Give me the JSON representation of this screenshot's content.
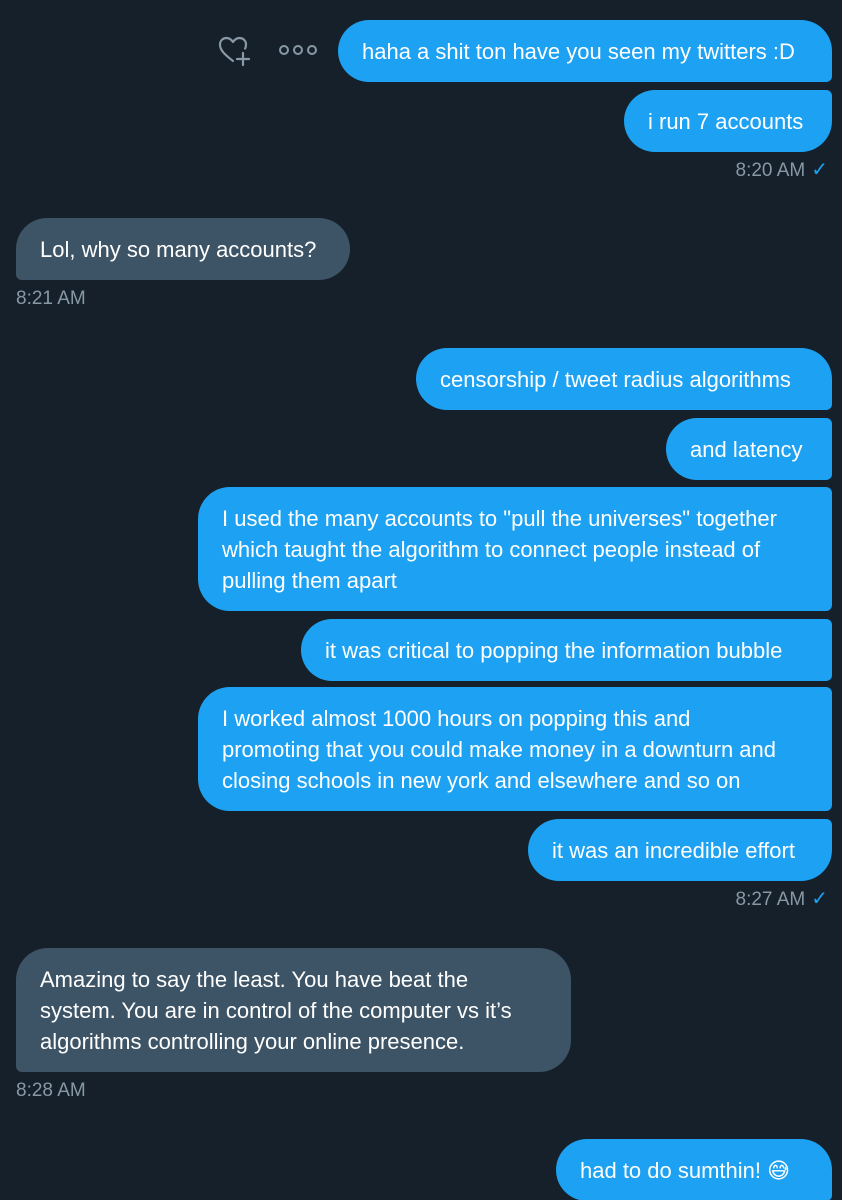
{
  "conversation": {
    "messages": [
      {
        "id": "m1",
        "text": "haha a shit ton have you seen my twitters :D"
      },
      {
        "id": "m2",
        "text": "i run 7 accounts"
      },
      {
        "id": "m3",
        "text": "Lol, why so many accounts?"
      },
      {
        "id": "m4",
        "text": "censorship / tweet radius algorithms"
      },
      {
        "id": "m5",
        "text": "and latency"
      },
      {
        "id": "m6",
        "text": "I used the many accounts to \"pull the universes\" together\nwhich taught the algorithm to connect people instead of\npulling them apart"
      },
      {
        "id": "m7",
        "text": "it was critical to popping the information bubble"
      },
      {
        "id": "m8",
        "text": "I worked almost 1000 hours on popping this and\npromoting that you could make money in a downturn and\nclosing schools in new york and elsewhere and so on"
      },
      {
        "id": "m9",
        "text": "it was an incredible effort"
      },
      {
        "id": "m10",
        "text": "Amazing to say the least. You have beat the\nsystem. You are in control of the computer vs it’s\nalgorithms controlling your online presence."
      },
      {
        "id": "m11",
        "text": "had to do sumthin! 😅"
      }
    ],
    "timestamps": {
      "t1": "8:20 AM",
      "t2": "8:21 AM",
      "t3": "8:27 AM",
      "t4": "8:28 AM"
    },
    "read_check": "✓"
  },
  "icons": {
    "like": "heart-plus-icon",
    "more": "more-options-icon"
  },
  "colors": {
    "background": "#15202b",
    "sent_bubble": "#1da1f2",
    "received_bubble": "#3d5466",
    "timestamp": "#8899a6",
    "read_check": "#1da1f2"
  }
}
